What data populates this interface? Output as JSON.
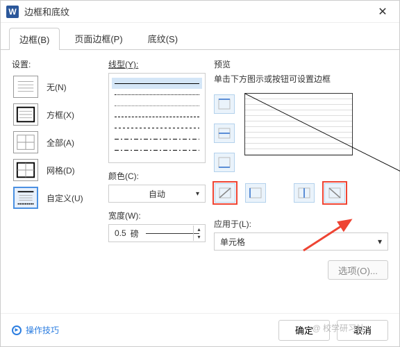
{
  "title": "边框和底纹",
  "tabs": {
    "borders": "边框(B)",
    "pageborders": "页面边框(P)",
    "shading": "底纹(S)"
  },
  "settings": {
    "label": "设置:",
    "items": [
      "无(N)",
      "方框(X)",
      "全部(A)",
      "网格(D)",
      "自定义(U)"
    ]
  },
  "style": {
    "label": "线型(Y):",
    "color_label": "颜色(C):",
    "color_value": "自动",
    "width_label": "宽度(W):",
    "width_value": "0.5",
    "width_unit": "磅"
  },
  "preview": {
    "label": "预览",
    "hint": "单击下方图示或按钮可设置边框",
    "apply_label": "应用于(L):",
    "apply_value": "单元格",
    "options": "选项(O)..."
  },
  "footer": {
    "tips": "操作技巧",
    "ok": "确定",
    "cancel": "取消"
  },
  "watermark": "@ 校学研习社"
}
